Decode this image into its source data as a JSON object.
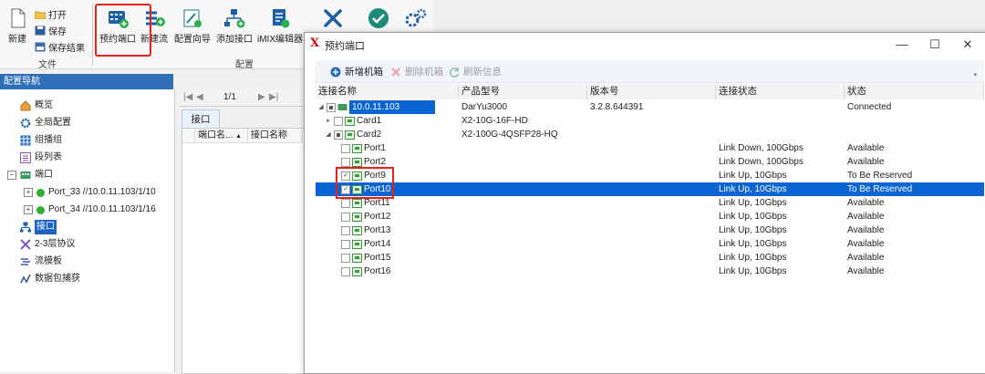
{
  "ribbon": {
    "file_group": {
      "new_label": "新建",
      "open_label": "打开",
      "save_label": "保存",
      "save_result_label": "保存结果",
      "group_label": "文件"
    },
    "config_group": {
      "buttons": [
        "预约端口",
        "新建流",
        "配置向导",
        "添加接口",
        "iMIX编辑器"
      ],
      "group_label": "配置"
    }
  },
  "nav": {
    "header": "配置导航",
    "items": [
      {
        "label": "概览",
        "icon": "home-icon"
      },
      {
        "label": "全局配置",
        "icon": "gear-icon"
      },
      {
        "label": "组播组",
        "icon": "grid-icon"
      },
      {
        "label": "段列表",
        "icon": "list-icon"
      },
      {
        "label": "端口",
        "icon": "port-icon"
      },
      {
        "label": "Port_33 //10.0.11.103/1/10",
        "icon": "status-dot-icon"
      },
      {
        "label": "Port_34 //10.0.11.103/1/16",
        "icon": "status-dot-icon"
      },
      {
        "label": "接口",
        "icon": "interface-icon"
      },
      {
        "label": "2-3层协议",
        "icon": "protocol-icon"
      },
      {
        "label": "流模板",
        "icon": "stream-icon"
      },
      {
        "label": "数据包捕获",
        "icon": "capture-icon"
      }
    ]
  },
  "middle": {
    "pager": "1/1",
    "tab": "接口",
    "columns": [
      "端口名...",
      "接口名称"
    ]
  },
  "dialog": {
    "title": "预约端口",
    "toolbar": {
      "add": "新增机箱",
      "delete": "删除机箱",
      "refresh": "刷新信息"
    },
    "columns": [
      "连接名称",
      "产品型号",
      "版本号",
      "连接状态",
      "状态"
    ],
    "rows": [
      {
        "name": "10.0.11.103",
        "model": "DarYu3000",
        "version": "3.2.8.644391",
        "link": "",
        "status": "Connected"
      },
      {
        "name": "Card1",
        "model": "X2-10G-16F-HD",
        "version": "",
        "link": "",
        "status": ""
      },
      {
        "name": "Card2",
        "model": "X2-100G-4QSFP28-HQ",
        "version": "",
        "link": "",
        "status": ""
      },
      {
        "name": "Port1",
        "model": "",
        "version": "",
        "link": "Link Down, 100Gbps",
        "status": "Available"
      },
      {
        "name": "Port2",
        "model": "",
        "version": "",
        "link": "Link Down, 100Gbps",
        "status": "Available"
      },
      {
        "name": "Port9",
        "model": "",
        "version": "",
        "link": "Link Up, 10Gbps",
        "status": "To Be Reserved"
      },
      {
        "name": "Port10",
        "model": "",
        "version": "",
        "link": "Link Up, 10Gbps",
        "status": "To Be Reserved"
      },
      {
        "name": "Port11",
        "model": "",
        "version": "",
        "link": "Link Up, 10Gbps",
        "status": "Available"
      },
      {
        "name": "Port12",
        "model": "",
        "version": "",
        "link": "Link Up, 10Gbps",
        "status": "Available"
      },
      {
        "name": "Port13",
        "model": "",
        "version": "",
        "link": "Link Up, 10Gbps",
        "status": "Available"
      },
      {
        "name": "Port14",
        "model": "",
        "version": "",
        "link": "Link Up, 10Gbps",
        "status": "Available"
      },
      {
        "name": "Port15",
        "model": "",
        "version": "",
        "link": "Link Up, 10Gbps",
        "status": "Available"
      },
      {
        "name": "Port16",
        "model": "",
        "version": "",
        "link": "Link Up, 10Gbps",
        "status": "Available"
      }
    ]
  },
  "colors": {
    "accent": "#2e6fb7",
    "selection": "#0a64d2",
    "highlight_box": "#e2231a"
  }
}
